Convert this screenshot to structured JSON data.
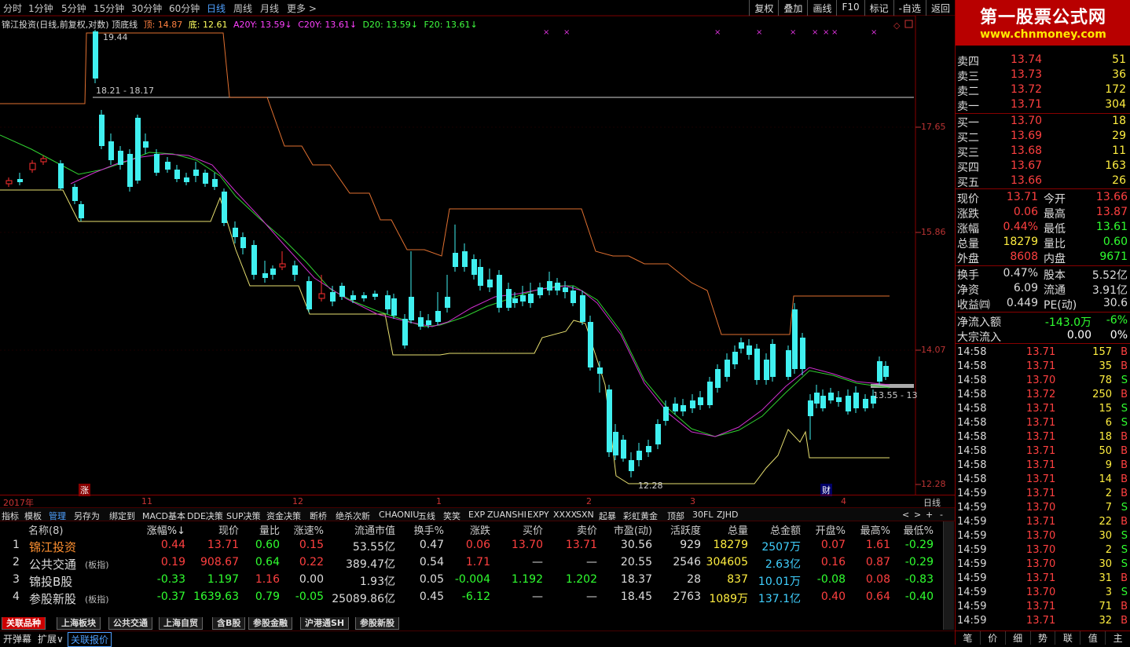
{
  "toolbar": {
    "periods": [
      "分时",
      "1分钟",
      "5分钟",
      "15分钟",
      "30分钟",
      "60分钟",
      "日线",
      "周线",
      "月线",
      "更多 >"
    ],
    "active": "日线",
    "right": [
      "复权",
      "叠加",
      "画线",
      "F10",
      "标记",
      "-自选",
      "返回"
    ]
  },
  "chart": {
    "title": "锦江投资(日线,前复权,对数) 顶底线",
    "ind": [
      {
        "t": "顶: 14.87",
        "c": "#ff8040"
      },
      {
        "t": "底: 12.61",
        "c": "#ffff60"
      },
      {
        "t": "A20Y: 13.59↓",
        "c": "#ff40ff"
      },
      {
        "t": "C20Y: 13.61↓",
        "c": "#ff40ff"
      },
      {
        "t": "D20: 13.59↓",
        "c": "#40ff40"
      },
      {
        "t": "F20: 13.61↓",
        "c": "#40ff40"
      }
    ],
    "high_label": "19.44",
    "mid_label": "18.21 - 18.17",
    "low_label": "12.28",
    "right_label": "13.55 - 13",
    "y_ticks": [
      "17.65",
      "15.86",
      "14.07",
      "12.28"
    ],
    "x_labels": [
      "2017年",
      "11",
      "12",
      "1",
      "2",
      "3",
      "4"
    ],
    "x_unit": "日线",
    "marks": {
      "zhang": "涨",
      "cai": "财"
    }
  },
  "tabs": {
    "items": [
      "指标",
      "模板",
      "管理",
      "另存为",
      "绑定到",
      "MACD基本",
      "DDE决策",
      "SUP决策",
      "资金决策",
      "断桥",
      "绝杀次新",
      "CHAONIU",
      "五线",
      "笑笑",
      "EXP",
      "ZUANSHI",
      "EXPY",
      "XXXX",
      "SXN",
      "起暴",
      "彩虹黄金",
      "顶部",
      "30FL",
      "ZJHD"
    ],
    "active": "管理",
    "ctrl": [
      "<",
      ">",
      "+",
      "-"
    ]
  },
  "table": {
    "headers": [
      "名称(8)",
      "涨幅%↓",
      "现价",
      "量比",
      "涨速%",
      "流通市值",
      "换手%",
      "涨跌",
      "买价",
      "卖价",
      "市盈(动)",
      "活跃度",
      "总量",
      "总金额",
      "开盘%",
      "最高%",
      "最低%"
    ],
    "rows": [
      [
        "1",
        "锦江投资",
        "",
        "0.44",
        "13.71",
        "0.60",
        "0.15",
        "53.55亿",
        "0.47",
        "0.06",
        "13.70",
        "13.71",
        "30.56",
        "929",
        "18279",
        "2507万",
        "0.07",
        "1.61",
        "-0.29"
      ],
      [
        "2",
        "公共交通",
        "(板指)",
        "0.19",
        "908.67",
        "0.64",
        "0.22",
        "389.47亿",
        "0.54",
        "1.71",
        "—",
        "—",
        "20.55",
        "2546",
        "304605",
        "2.63亿",
        "0.16",
        "0.87",
        "-0.29"
      ],
      [
        "3",
        "锦投B股",
        "",
        "-0.33",
        "1.197",
        "1.16",
        "0.00",
        "1.93亿",
        "0.05",
        "-0.004",
        "1.192",
        "1.202",
        "18.37",
        "28",
        "837",
        "10.01万",
        "-0.08",
        "0.08",
        "-0.83"
      ],
      [
        "4",
        "参股新股",
        "(板指)",
        "-0.37",
        "1639.63",
        "0.79",
        "-0.05",
        "25089.86亿",
        "0.45",
        "-6.12",
        "—",
        "—",
        "18.45",
        "2763",
        "1089万",
        "137.1亿",
        "0.40",
        "0.64",
        "-0.40"
      ]
    ]
  },
  "bottom_tabs": {
    "items": [
      "关联品种",
      "上海板块",
      "公共交通",
      "上海自贸",
      "含B股",
      "参股金融",
      "沪港通SH",
      "参股新股"
    ],
    "active": "关联品种"
  },
  "status": {
    "items": [
      "开弹幕",
      "扩展∨",
      "关联报价"
    ]
  },
  "brand": {
    "name": "第一股票公式网",
    "url": "www.chnmoney.com"
  },
  "orderbook": {
    "sell": [
      [
        "卖四",
        "13.74",
        "51"
      ],
      [
        "卖三",
        "13.73",
        "36"
      ],
      [
        "卖二",
        "13.72",
        "172"
      ],
      [
        "卖一",
        "13.71",
        "304"
      ]
    ],
    "buy": [
      [
        "买一",
        "13.70",
        "18"
      ],
      [
        "买二",
        "13.69",
        "29"
      ],
      [
        "买三",
        "13.68",
        "11"
      ],
      [
        "买四",
        "13.67",
        "163"
      ],
      [
        "买五",
        "13.66",
        "26"
      ]
    ]
  },
  "quote": [
    [
      "现价",
      "13.71",
      "今开",
      "13.66"
    ],
    [
      "涨跌",
      "0.06",
      "最高",
      "13.87"
    ],
    [
      "涨幅",
      "0.44%",
      "最低",
      "13.61"
    ],
    [
      "总量",
      "18279",
      "量比",
      "0.60"
    ],
    [
      "外盘",
      "8608",
      "内盘",
      "9671"
    ]
  ],
  "stats": [
    [
      "换手",
      "0.47%",
      "股本",
      "5.52亿"
    ],
    [
      "净资",
      "6.09",
      "流通",
      "3.91亿"
    ],
    [
      "收益㈣",
      "0.449",
      "PE(动)",
      "30.6"
    ]
  ],
  "flow": [
    [
      "净流入额",
      "-143.0万",
      "-6%"
    ],
    [
      "大宗流入",
      "0.00",
      "0%"
    ]
  ],
  "trades": [
    [
      "14:58",
      "13.71",
      "157",
      "B"
    ],
    [
      "14:58",
      "13.71",
      "35",
      "B"
    ],
    [
      "14:58",
      "13.70",
      "78",
      "S"
    ],
    [
      "14:58",
      "13.72",
      "250",
      "B"
    ],
    [
      "14:58",
      "13.71",
      "15",
      "S"
    ],
    [
      "14:58",
      "13.71",
      "6",
      "S"
    ],
    [
      "14:58",
      "13.71",
      "18",
      "B"
    ],
    [
      "14:58",
      "13.71",
      "50",
      "B"
    ],
    [
      "14:58",
      "13.71",
      "9",
      "B"
    ],
    [
      "14:58",
      "13.71",
      "14",
      "B"
    ],
    [
      "14:59",
      "13.71",
      "2",
      "B"
    ],
    [
      "14:59",
      "13.70",
      "7",
      "S"
    ],
    [
      "14:59",
      "13.71",
      "22",
      "B"
    ],
    [
      "14:59",
      "13.70",
      "30",
      "S"
    ],
    [
      "14:59",
      "13.70",
      "2",
      "S"
    ],
    [
      "14:59",
      "13.70",
      "30",
      "S"
    ],
    [
      "14:59",
      "13.71",
      "31",
      "B"
    ],
    [
      "14:59",
      "13.70",
      "3",
      "S"
    ],
    [
      "14:59",
      "13.71",
      "71",
      "B"
    ],
    [
      "14:59",
      "13.71",
      "32",
      "B"
    ]
  ],
  "right_bottom": [
    "笔",
    "价",
    "细",
    "势",
    "联",
    "值",
    "主"
  ]
}
